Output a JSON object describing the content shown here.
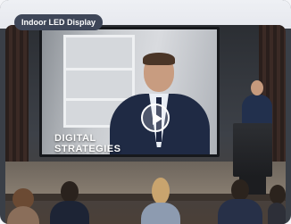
{
  "badge": {
    "label": "Indoor LED Display"
  },
  "screen": {
    "overlay_line1": "DIGITAL",
    "overlay_line2": "STRATEGIES"
  },
  "video": {
    "play_icon": "play-icon"
  },
  "colors": {
    "badge_bg": "#3e4658",
    "suit": "#1f2a44"
  }
}
